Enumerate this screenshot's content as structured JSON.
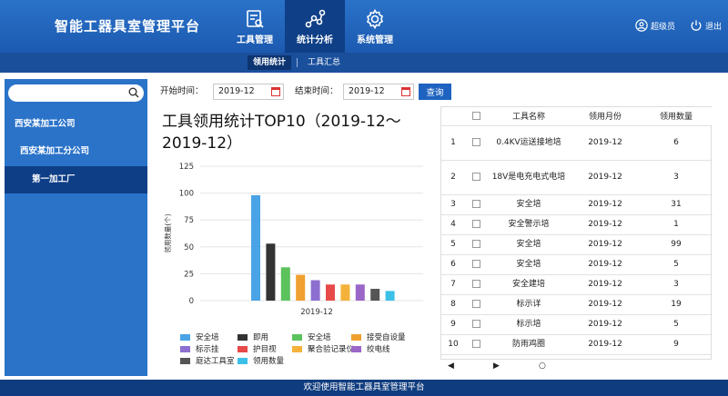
{
  "header": {
    "brand": "智能工器具室管理平台",
    "tabs": [
      {
        "label": "工具管理",
        "icon": "tool-list-icon"
      },
      {
        "label": "统计分析",
        "icon": "analysis-icon"
      },
      {
        "label": "系统管理",
        "icon": "gear-icon"
      }
    ],
    "user_label": "超级员",
    "logout_label": "退出"
  },
  "subnav": {
    "items": [
      "领用统计",
      "工具汇总"
    ]
  },
  "sidebar": {
    "search_placeholder": "",
    "tree": [
      "西安某加工公司",
      "西安某加工分公司",
      "第一加工厂"
    ]
  },
  "filter": {
    "start_label": "开始时间：",
    "start_value": "2019-12",
    "end_label": "结束时间：",
    "end_value": "2019-12",
    "query_label": "查询"
  },
  "chart_data": {
    "type": "bar",
    "title": "工具领用统计TOP10（2019-12～2019-12）",
    "ylabel": "领用数量(个)",
    "ylim": [
      0,
      125
    ],
    "yticks": [
      "0",
      "25",
      "50",
      "75",
      "100",
      "125"
    ],
    "xlabel": "2019-12",
    "series": [
      {
        "name": "安全培",
        "value": 98,
        "color": "#4aa3e6"
      },
      {
        "name": "即用",
        "value": 53,
        "color": "#333333"
      },
      {
        "name": "安全培",
        "value": 31,
        "color": "#5cc25c"
      },
      {
        "name": "接受自设量",
        "value": 24,
        "color": "#f0a030"
      },
      {
        "name": "标示挂",
        "value": 19,
        "color": "#8c6fd0"
      },
      {
        "name": "护目视",
        "value": 15,
        "color": "#e84a4a"
      },
      {
        "name": "聚合验记录仪",
        "value": 15,
        "color": "#f5b23a"
      },
      {
        "name": "绞电线",
        "value": 15,
        "color": "#9a66c8"
      },
      {
        "name": "庭达工具室",
        "value": 11,
        "color": "#555555"
      },
      {
        "name": "领用数量",
        "value": 9,
        "color": "#3cc0e8"
      }
    ]
  },
  "table": {
    "headers": [
      "",
      "",
      "工具名称",
      "领用月份",
      "领用数量"
    ],
    "rows": [
      [
        "1",
        "0.4KV运送接地培",
        "2019-12",
        "6"
      ],
      [
        "2",
        "18V是电充电式电培",
        "2019-12",
        "3"
      ],
      [
        "3",
        "安全培",
        "2019-12",
        "31"
      ],
      [
        "4",
        "安全警示培",
        "2019-12",
        "1"
      ],
      [
        "5",
        "安全培",
        "2019-12",
        "99"
      ],
      [
        "6",
        "安全培",
        "2019-12",
        "5"
      ],
      [
        "7",
        "安全建培",
        "2019-12",
        "3"
      ],
      [
        "8",
        "标示详",
        "2019-12",
        "19"
      ],
      [
        "9",
        "标示培",
        "2019-12",
        "5"
      ],
      [
        "10",
        "防雨鸡圈",
        "2019-12",
        "9"
      ]
    ]
  },
  "footer": {
    "text": "欢迎使用智能工器具室管理平台"
  }
}
